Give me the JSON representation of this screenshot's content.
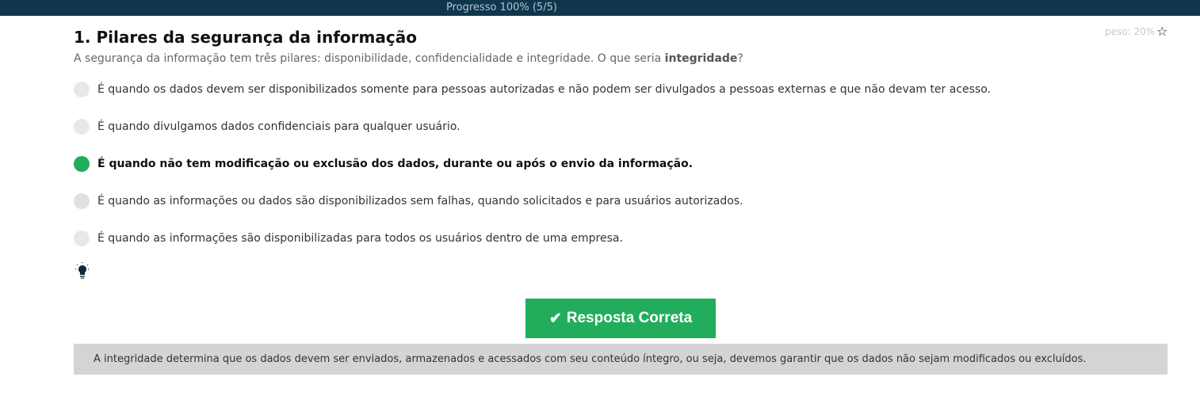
{
  "header": {
    "progress": "Progresso 100% (5/5)"
  },
  "question": {
    "number": "1.",
    "title": "Pilares da segurança da informação",
    "subtitle_prefix": "A segurança da informação tem três pilares: disponibilidade, confidencialidade e integridade. O que seria ",
    "subtitle_bold": "integridade",
    "subtitle_suffix": "?",
    "weight": "peso: 20%",
    "options": [
      {
        "label": "É quando os dados devem ser disponibilizados somente para pessoas autorizadas e não podem ser divulgados a pessoas externas e que não devam ter acesso.",
        "selected": false
      },
      {
        "label": "É quando divulgamos dados confidenciais para qualquer usuário.",
        "selected": false
      },
      {
        "label": "É quando não tem modificação ou exclusão dos dados, durante ou após o envio da informação.",
        "selected": true
      },
      {
        "label": "É quando as informações ou dados são disponibilizados sem falhas, quando solicitados e para usuários autorizados.",
        "selected": false
      },
      {
        "label": "É quando as informações são disponibilizadas para todos os usuários dentro de uma empresa.",
        "selected": false
      }
    ]
  },
  "result": {
    "label": "Resposta Correta",
    "icon": "check-icon",
    "color": "#22ad5c"
  },
  "explanation": "A integridade determina que os dados devem ser enviados, armazenados e acessados com seu conteúdo íntegro, ou seja, devemos garantir que os dados não sejam modificados ou excluídos."
}
